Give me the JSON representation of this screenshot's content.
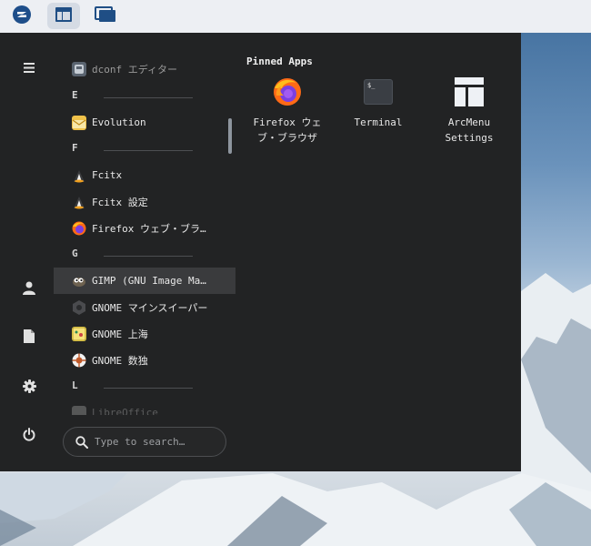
{
  "top_panel": {
    "buttons": [
      {
        "name": "zorin-menu-button",
        "icon": "zorin-logo-icon"
      },
      {
        "name": "layout-button",
        "icon": "layout-icon",
        "active": true
      },
      {
        "name": "windows-button",
        "icon": "windows-icon"
      }
    ]
  },
  "rail": {
    "icons": [
      "hamburger-menu-icon",
      "user-icon",
      "document-icon",
      "settings-gear-icon",
      "power-icon"
    ]
  },
  "app_list": {
    "items": [
      {
        "type": "app",
        "label": "dconf エディター",
        "icon": "dconf-icon",
        "style": "dim"
      },
      {
        "type": "header",
        "label": "E"
      },
      {
        "type": "app",
        "label": "Evolution",
        "icon": "evolution-icon"
      },
      {
        "type": "header",
        "label": "F"
      },
      {
        "type": "app",
        "label": "Fcitx",
        "icon": "fcitx-icon"
      },
      {
        "type": "app",
        "label": "Fcitx 設定",
        "icon": "fcitx-icon"
      },
      {
        "type": "app",
        "label": "Firefox ウェブ・ブラウザ",
        "icon": "firefox-icon"
      },
      {
        "type": "header",
        "label": "G"
      },
      {
        "type": "app",
        "label": "GIMP (GNU Image Manipulation Program)",
        "icon": "gimp-icon",
        "selected": true
      },
      {
        "type": "app",
        "label": "GNOME マインスイーパー",
        "icon": "mines-icon"
      },
      {
        "type": "app",
        "label": "GNOME 上海",
        "icon": "mahjongg-icon"
      },
      {
        "type": "app",
        "label": "GNOME 数独",
        "icon": "sudoku-icon"
      },
      {
        "type": "header",
        "label": "L"
      },
      {
        "type": "app",
        "label": "LibreOffice",
        "icon": "libreoffice-icon",
        "style": "faded"
      }
    ]
  },
  "search": {
    "placeholder": "Type to search…"
  },
  "pinned": {
    "title": "Pinned Apps",
    "apps": [
      {
        "label": "Firefox ウェ ブ・ブラウザ",
        "icon": "firefox-icon"
      },
      {
        "label": "Terminal",
        "icon": "terminal-icon"
      },
      {
        "label": "ArcMenu Settings",
        "icon": "arcmenu-settings-icon"
      }
    ]
  },
  "colors": {
    "menu_bg": "#222324",
    "panel_bg": "#edeff3",
    "selection": "#3a3b3d"
  }
}
